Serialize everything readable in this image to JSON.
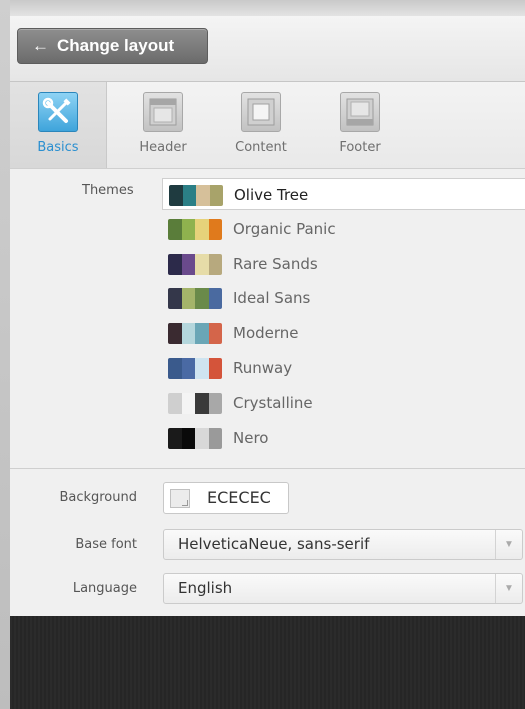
{
  "toolbar": {
    "change_layout_label": "Change layout"
  },
  "tabs": [
    {
      "label": "Basics",
      "icon": "wrench-screwdriver-icon",
      "active": true
    },
    {
      "label": "Header",
      "icon": "layout-header-icon",
      "active": false
    },
    {
      "label": "Content",
      "icon": "layout-content-icon",
      "active": false
    },
    {
      "label": "Footer",
      "icon": "layout-footer-icon",
      "active": false
    }
  ],
  "themes": {
    "label": "Themes",
    "selected": "Olive Tree",
    "items": [
      {
        "name": "Olive Tree",
        "colors": [
          "#1f3b40",
          "#2b7f86",
          "#d6c09a",
          "#a8a36a"
        ]
      },
      {
        "name": "Organic Panic",
        "colors": [
          "#5a7d3a",
          "#8fb24e",
          "#e6d27a",
          "#e07a1c"
        ]
      },
      {
        "name": "Rare Sands",
        "colors": [
          "#2c2a4a",
          "#6a4a8c",
          "#e6dca8",
          "#b7a97e"
        ]
      },
      {
        "name": "Ideal Sans",
        "colors": [
          "#34374a",
          "#a4b46a",
          "#6a8a4a",
          "#4a6aa0"
        ]
      },
      {
        "name": "Moderne",
        "colors": [
          "#3a2a30",
          "#b4d6dc",
          "#6aa6b6",
          "#d4654a"
        ]
      },
      {
        "name": "Runway",
        "colors": [
          "#3a5a8c",
          "#4a6aa4",
          "#cfe4f0",
          "#d4543a"
        ]
      },
      {
        "name": "Crystalline",
        "colors": [
          "#cfcfcf",
          "#f4f4f4",
          "#3a3a3a",
          "#a8a8a8"
        ]
      },
      {
        "name": "Nero",
        "colors": [
          "#1a1a1a",
          "#0a0a0a",
          "#d8d8d8",
          "#9a9a9a"
        ]
      }
    ]
  },
  "background": {
    "label": "Background",
    "value": "ECECEC"
  },
  "base_font": {
    "label": "Base font",
    "value": "HelveticaNeue, sans-serif"
  },
  "language": {
    "label": "Language",
    "value": "English"
  },
  "colors": {
    "active_tab": "#2a8fd0",
    "panel_bg": "#f0f0f0",
    "footer_dark": "#2a2a2a"
  }
}
